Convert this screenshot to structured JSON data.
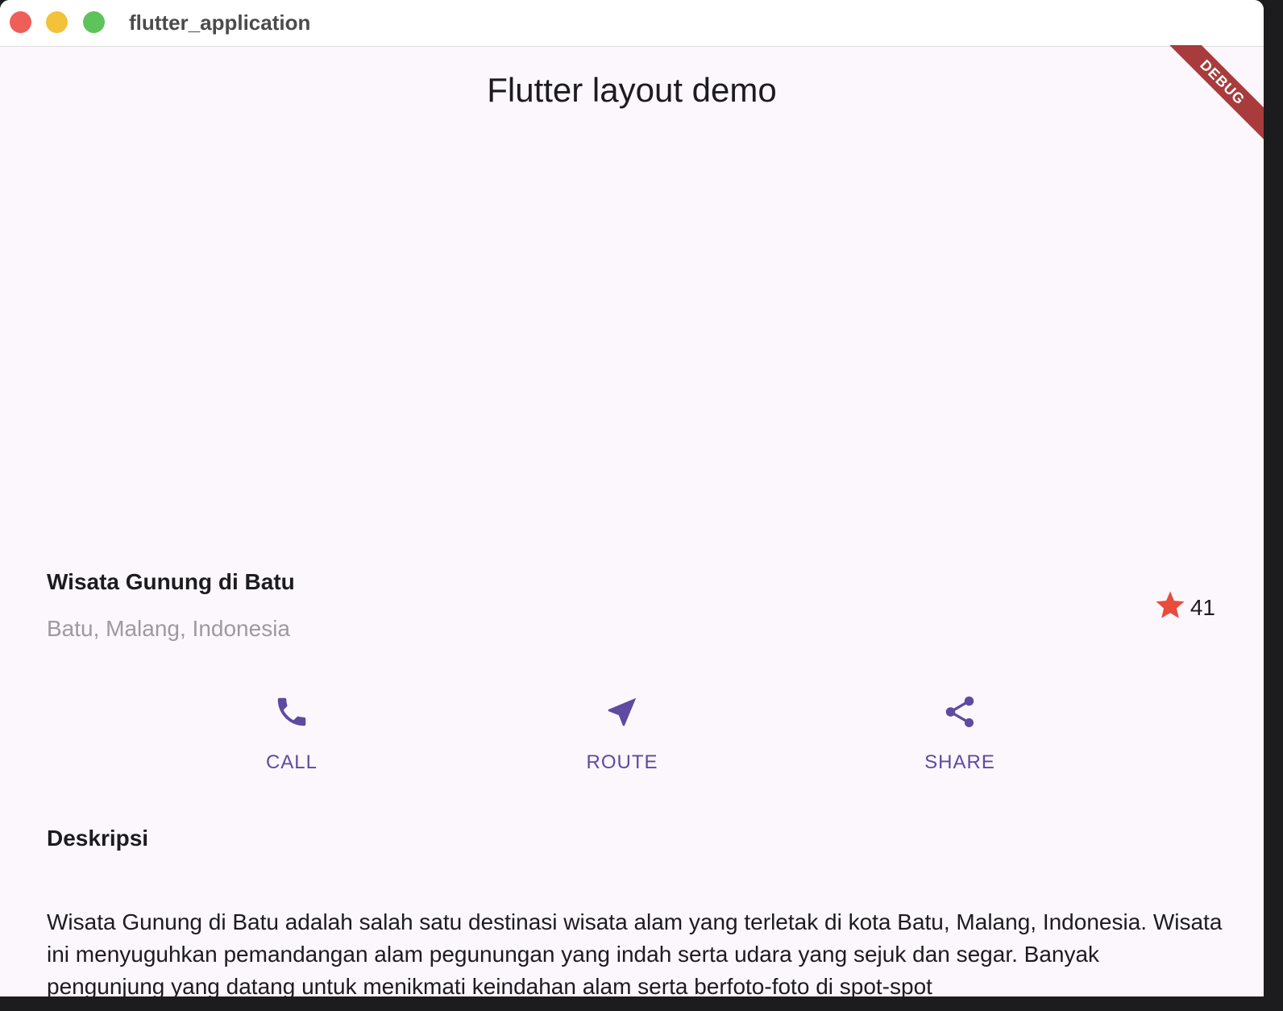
{
  "window": {
    "title": "flutter_application"
  },
  "debug_banner": {
    "label": "DEBUG"
  },
  "appbar": {
    "title": "Flutter layout demo"
  },
  "title_section": {
    "name": "Wisata Gunung di Batu",
    "location": "Batu, Malang, Indonesia",
    "rating_count": "41",
    "star_color": "#e74c3c"
  },
  "buttons": {
    "color": "#5e4aa0",
    "call": {
      "label": "CALL",
      "icon": "phone-icon"
    },
    "route": {
      "label": "ROUTE",
      "icon": "near-me-icon"
    },
    "share": {
      "label": "SHARE",
      "icon": "share-icon"
    }
  },
  "description": {
    "heading": "Deskripsi",
    "text": "Wisata Gunung di Batu adalah salah satu destinasi wisata alam yang terletak di kota Batu, Malang, Indonesia. Wisata ini menyuguhkan pemandangan alam pegunungan yang indah serta udara yang sejuk dan segar. Banyak pengunjung yang datang untuk menikmati keindahan alam serta berfoto-foto di spot-spot"
  }
}
